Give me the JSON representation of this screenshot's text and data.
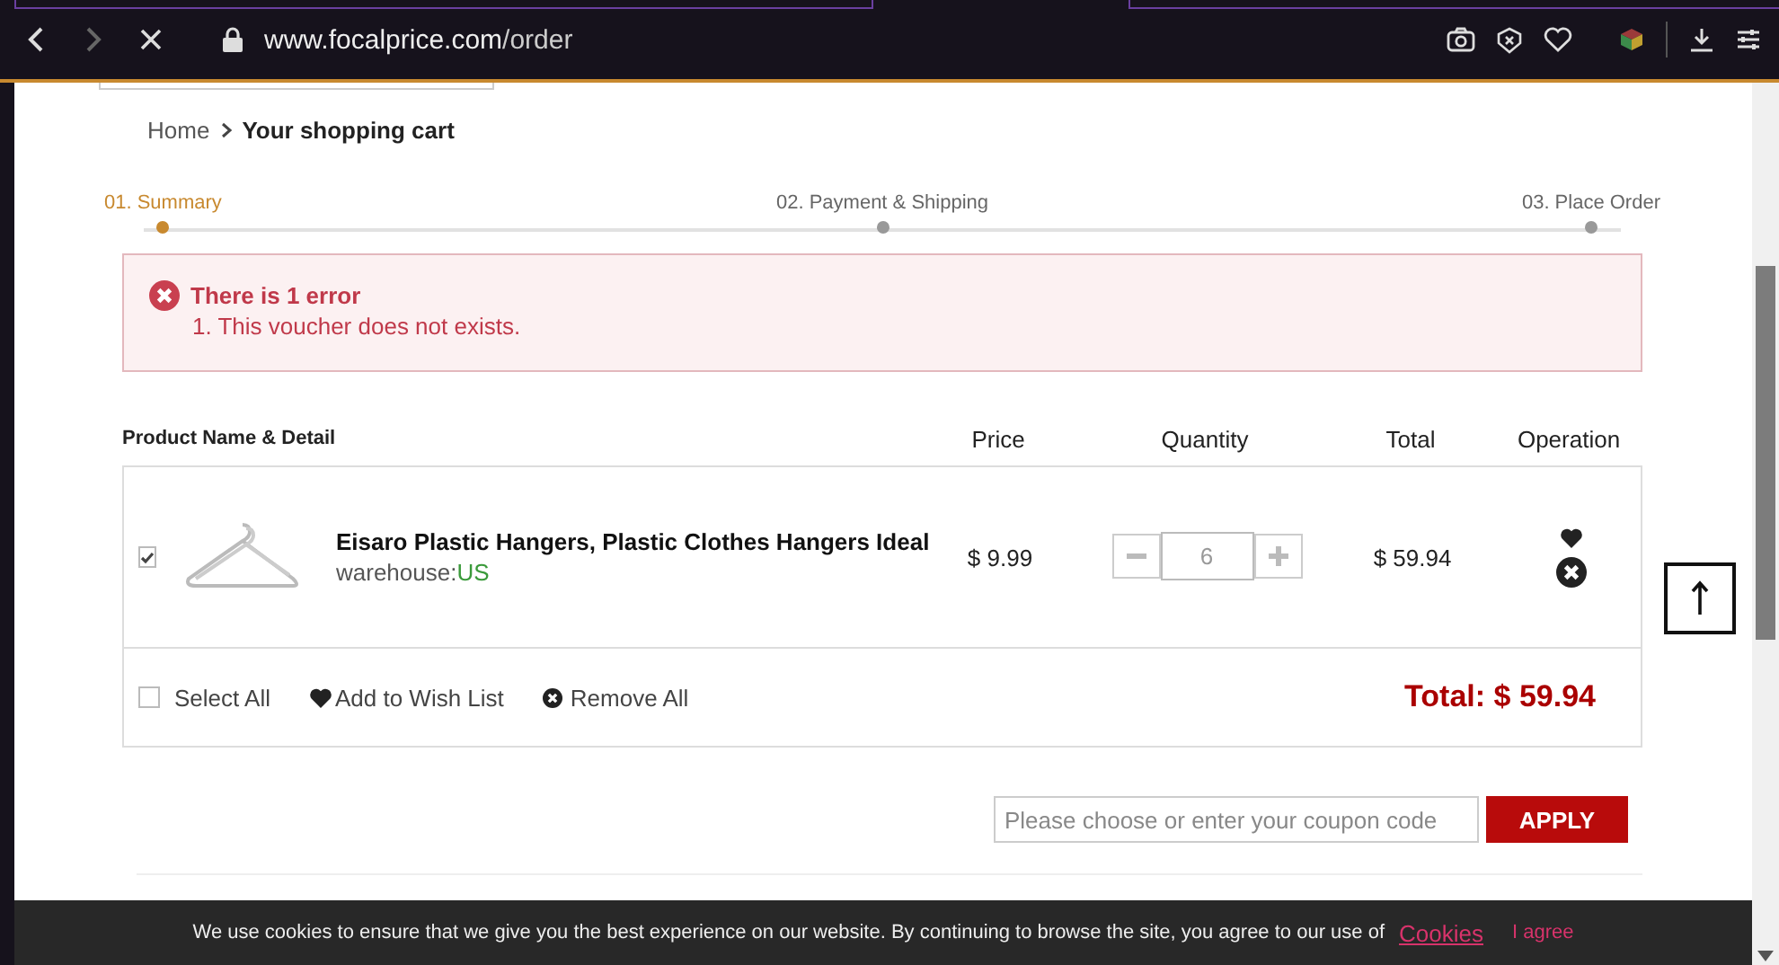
{
  "browser": {
    "url_host": "www.focalprice.com",
    "url_path": "/order"
  },
  "breadcrumb": [
    {
      "label": "Home"
    },
    {
      "label": "Your shopping cart"
    }
  ],
  "steps": [
    {
      "label": "01. Summary",
      "selected": true
    },
    {
      "label": "02. Payment & Shipping",
      "selected": false
    },
    {
      "label": "03. Place Order",
      "selected": false
    }
  ],
  "error": {
    "title": "There is 1 error",
    "messages": [
      "1. This voucher does not exists."
    ]
  },
  "table": {
    "columns": [
      "Product Name & Detail",
      "Price",
      "Quantity",
      "Total",
      "Operation"
    ],
    "rows": [
      {
        "checked": true,
        "name": "Eisaro Plastic Hangers, Plastic Clothes Hangers Ideal",
        "warehouse_label": "warehouse:",
        "warehouse": "US",
        "price": "$ 9.99",
        "quantity": "6",
        "total": "$ 59.94"
      }
    ]
  },
  "footer": {
    "select_all": {
      "label": "Select All",
      "checked": false
    },
    "wish_list": "Add to Wish List",
    "remove_all": "Remove All",
    "grand_total": "Total: $ 59.94"
  },
  "coupon": {
    "placeholder": "Please choose or enter your coupon code",
    "button": "APPLY"
  },
  "cookie_bar": {
    "text": "We use cookies to ensure that we give you the best experience on our website. By continuing to browse the site, you agree to our use of",
    "link": "Cookies",
    "agree": "I agree"
  }
}
